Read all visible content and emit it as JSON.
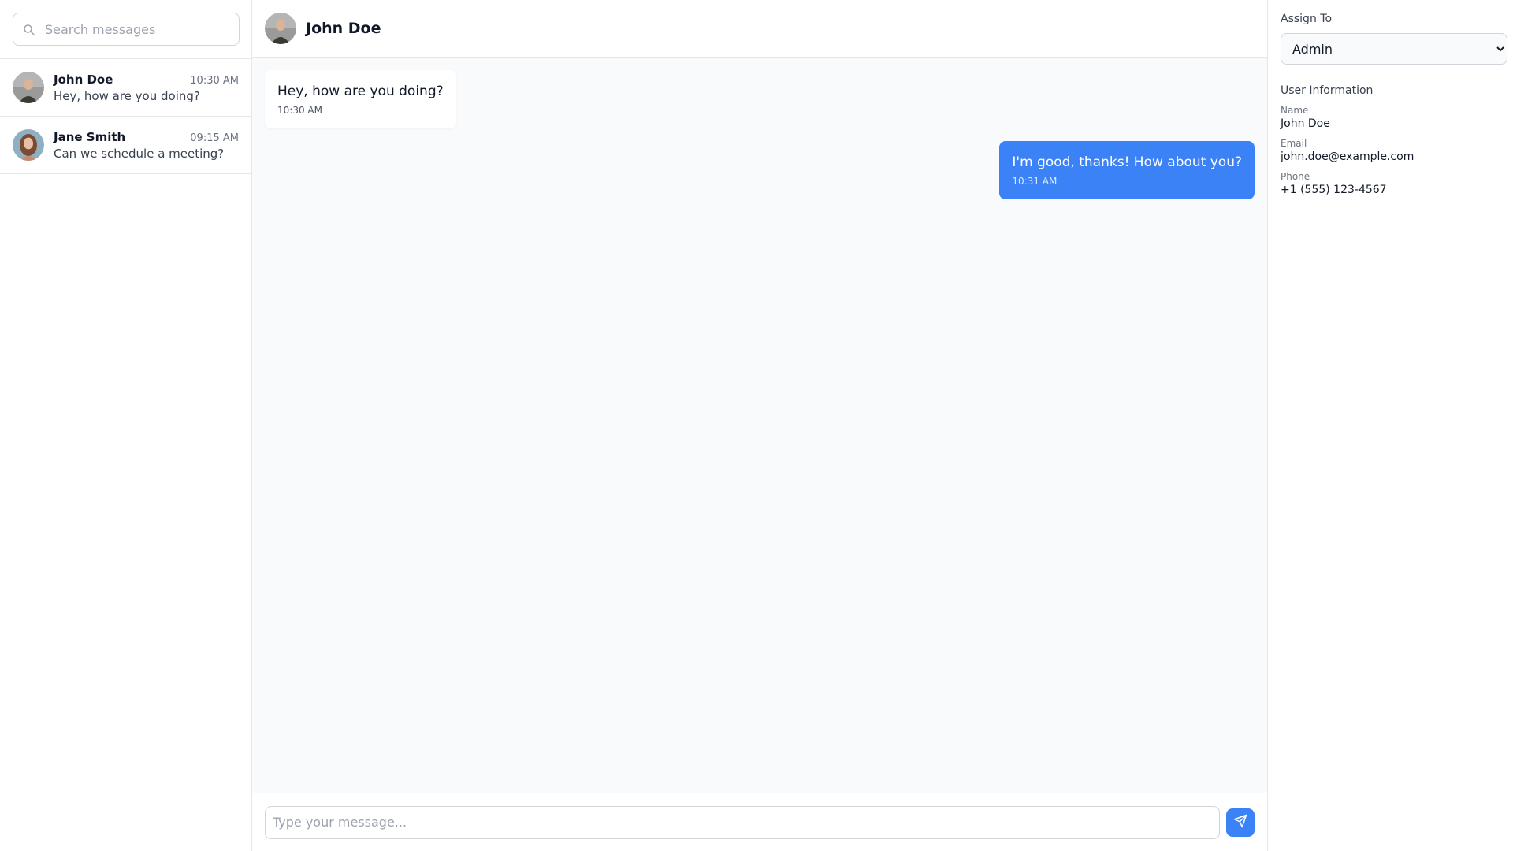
{
  "search": {
    "placeholder": "Search messages"
  },
  "conversations": [
    {
      "name": "John Doe",
      "time": "10:30 AM",
      "preview": "Hey, how are you doing?"
    },
    {
      "name": "Jane Smith",
      "time": "09:15 AM",
      "preview": "Can we schedule a meeting?"
    }
  ],
  "chat": {
    "contact_name": "John Doe",
    "messages": [
      {
        "direction": "in",
        "text": "Hey, how are you doing?",
        "time": "10:30 AM"
      },
      {
        "direction": "out",
        "text": "I'm good, thanks! How about you?",
        "time": "10:31 AM"
      }
    ],
    "composer_placeholder": "Type your message..."
  },
  "details": {
    "assign_label": "Assign To",
    "assign_selected": "Admin",
    "section_title": "User Information",
    "fields": [
      {
        "label": "Name",
        "value": "John Doe"
      },
      {
        "label": "Email",
        "value": "john.doe@example.com"
      },
      {
        "label": "Phone",
        "value": "+1 (555) 123-4567"
      }
    ]
  },
  "colors": {
    "accent": "#3b82f6",
    "border": "#e5e7eb",
    "chat_bg": "#f9fafb"
  },
  "icons": {
    "search": "search-icon",
    "send": "send-icon"
  }
}
